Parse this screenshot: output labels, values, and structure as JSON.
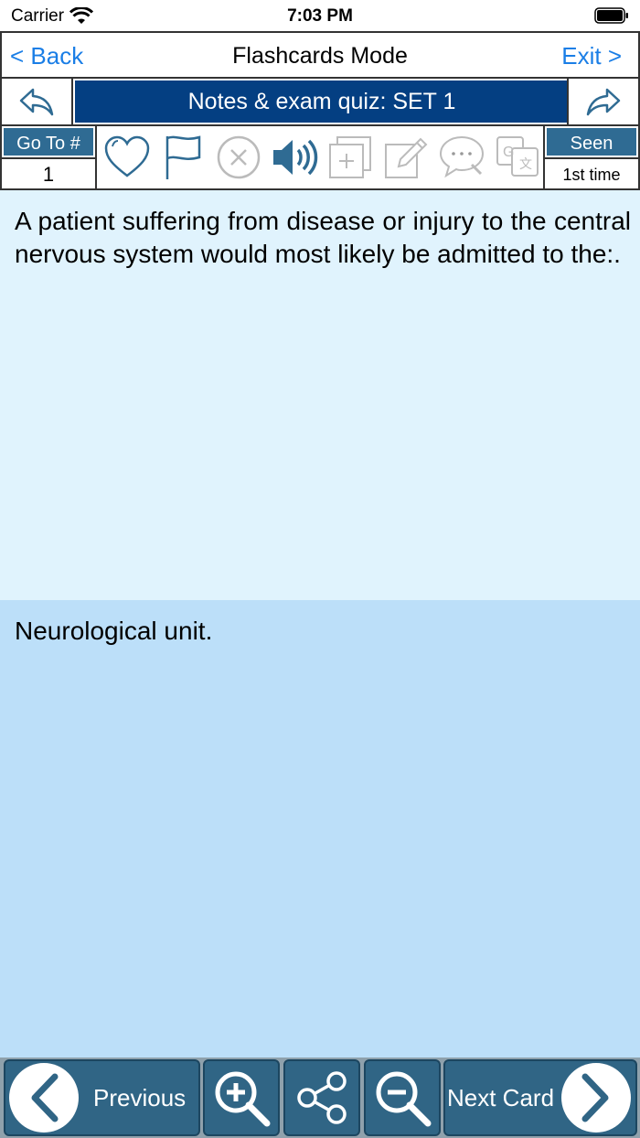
{
  "status": {
    "carrier": "Carrier",
    "time": "7:03 PM"
  },
  "nav": {
    "back_label": "< Back",
    "title": "Flashcards Mode",
    "exit_label": "Exit >"
  },
  "set": {
    "title": "Notes & exam quiz: SET 1"
  },
  "toolbar": {
    "goto_label": "Go To #",
    "goto_value": "1",
    "seen_label": "Seen",
    "seen_value": "1st time",
    "icons": [
      "heart-icon",
      "flag-icon",
      "close-circle-icon",
      "speaker-icon",
      "add-card-icon",
      "edit-icon",
      "comment-icon",
      "translate-icon"
    ]
  },
  "card": {
    "question": "A patient suffering from disease or injury to the central nervous system would most likely be admitted to the:.",
    "answer": "Neurological unit."
  },
  "bottom": {
    "previous_label": "Previous",
    "next_label": "Next Card"
  },
  "colors": {
    "accent_blue": "#1a7ee6",
    "set_banner": "#043f82",
    "header_label_bg": "#2f6b93",
    "question_bg": "#e0f3fd",
    "answer_bg": "#bcdff9",
    "button_bg": "#306585"
  }
}
